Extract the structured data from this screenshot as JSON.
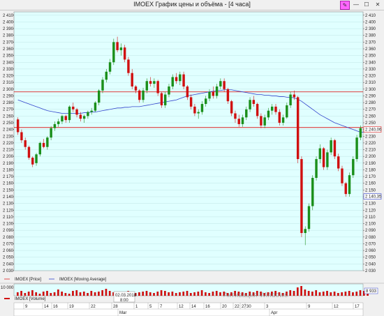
{
  "window": {
    "title": "IMOEX График цены и объёма - [4 часа]",
    "pin_icon": "pin-icon",
    "minimize_icon": "minimize-icon",
    "maximize_icon": "maximize-icon",
    "close_icon": "close-icon"
  },
  "colors": {
    "plot_bg": "#e0ffff",
    "up": "#1a8f1a",
    "down": "#d01010",
    "ma": "#3344cc",
    "level": "#dd2222",
    "grid": "#b8dede"
  },
  "price_labels": {
    "ma_value": "2 240,06",
    "last_price": "2 140,35"
  },
  "volume": {
    "axis_label": "10 000",
    "last_value": "8 933"
  },
  "legend": {
    "price": "IMOEX [Price]",
    "ma": "IMOEX [Moving Average]",
    "volume": "IMOEX [Volume]"
  },
  "cursor_label": {
    "date": "02.03.2018",
    "time": "8:00"
  },
  "watermark": "Активация Windows",
  "chart_data": {
    "type": "candlestick",
    "ylim": [
      2030,
      2415
    ],
    "y_ticks": [
      2030,
      2040,
      2050,
      2060,
      2070,
      2080,
      2090,
      2100,
      2110,
      2120,
      2130,
      2140,
      2150,
      2160,
      2170,
      2180,
      2190,
      2200,
      2210,
      2220,
      2230,
      2240,
      2250,
      2260,
      2270,
      2280,
      2290,
      2300,
      2310,
      2320,
      2330,
      2340,
      2350,
      2360,
      2370,
      2380,
      2390,
      2400,
      2410
    ],
    "y_tick_labels": [
      "2 030",
      "2 040",
      "2 050",
      "2 060",
      "2 070",
      "2 080",
      "2 090",
      "2 100",
      "2 110",
      "2 120",
      "2 130",
      "2 140",
      "2 150",
      "2 160",
      "2 170",
      "2 180",
      "2 190",
      "2 200",
      "2 210",
      "2 220",
      "2 230",
      "2 240",
      "2 250",
      "2 260",
      "2 270",
      "2 280",
      "2 290",
      "2 300",
      "2 310",
      "2 320",
      "2 330",
      "2 340",
      "2 350",
      "2 360",
      "2 370",
      "2 380",
      "2 390",
      "2 400",
      "2 410"
    ],
    "x_day_labels": [
      "9",
      "14",
      "16",
      "19",
      "22",
      "28",
      "1",
      "5",
      "7",
      "12",
      "14",
      "16",
      "20",
      "22",
      "27",
      "30",
      "3",
      "9",
      "12",
      "17"
    ],
    "month_labels": [
      "Mar",
      "Apr"
    ],
    "horizontal_levels": [
      2296,
      2243
    ],
    "ohlc": [
      [
        2255,
        2258,
        2232,
        2236
      ],
      [
        2236,
        2240,
        2220,
        2224
      ],
      [
        2224,
        2228,
        2210,
        2214
      ],
      [
        2214,
        2216,
        2195,
        2198
      ],
      [
        2198,
        2200,
        2184,
        2188
      ],
      [
        2190,
        2205,
        2186,
        2203
      ],
      [
        2203,
        2222,
        2200,
        2220
      ],
      [
        2220,
        2226,
        2212,
        2214
      ],
      [
        2214,
        2230,
        2210,
        2228
      ],
      [
        2228,
        2245,
        2224,
        2242
      ],
      [
        2242,
        2252,
        2238,
        2248
      ],
      [
        2248,
        2256,
        2244,
        2252
      ],
      [
        2252,
        2262,
        2248,
        2260
      ],
      [
        2260,
        2262,
        2250,
        2254
      ],
      [
        2254,
        2276,
        2250,
        2274
      ],
      [
        2274,
        2280,
        2266,
        2270
      ],
      [
        2270,
        2272,
        2258,
        2262
      ],
      [
        2262,
        2266,
        2252,
        2256
      ],
      [
        2256,
        2262,
        2250,
        2260
      ],
      [
        2260,
        2268,
        2256,
        2266
      ],
      [
        2266,
        2272,
        2262,
        2268
      ],
      [
        2268,
        2282,
        2266,
        2280
      ],
      [
        2280,
        2300,
        2276,
        2298
      ],
      [
        2298,
        2318,
        2294,
        2314
      ],
      [
        2314,
        2330,
        2310,
        2326
      ],
      [
        2326,
        2345,
        2322,
        2340
      ],
      [
        2340,
        2375,
        2336,
        2370
      ],
      [
        2370,
        2378,
        2355,
        2358
      ],
      [
        2358,
        2368,
        2350,
        2362
      ],
      [
        2362,
        2366,
        2340,
        2344
      ],
      [
        2344,
        2348,
        2320,
        2324
      ],
      [
        2324,
        2330,
        2300,
        2304
      ],
      [
        2304,
        2306,
        2294,
        2298
      ],
      [
        2298,
        2300,
        2280,
        2284
      ],
      [
        2284,
        2302,
        2280,
        2298
      ],
      [
        2298,
        2316,
        2294,
        2312
      ],
      [
        2312,
        2318,
        2304,
        2308
      ],
      [
        2308,
        2316,
        2302,
        2312
      ],
      [
        2312,
        2314,
        2290,
        2294
      ],
      [
        2294,
        2296,
        2272,
        2276
      ],
      [
        2276,
        2296,
        2272,
        2292
      ],
      [
        2292,
        2308,
        2288,
        2304
      ],
      [
        2304,
        2322,
        2300,
        2318
      ],
      [
        2318,
        2324,
        2308,
        2312
      ],
      [
        2312,
        2326,
        2306,
        2322
      ],
      [
        2322,
        2326,
        2300,
        2304
      ],
      [
        2304,
        2306,
        2284,
        2288
      ],
      [
        2288,
        2292,
        2270,
        2274
      ],
      [
        2274,
        2278,
        2260,
        2264
      ],
      [
        2264,
        2270,
        2256,
        2266
      ],
      [
        2266,
        2282,
        2262,
        2278
      ],
      [
        2278,
        2290,
        2274,
        2286
      ],
      [
        2286,
        2300,
        2282,
        2296
      ],
      [
        2296,
        2304,
        2286,
        2290
      ],
      [
        2290,
        2308,
        2286,
        2304
      ],
      [
        2304,
        2316,
        2300,
        2312
      ],
      [
        2312,
        2316,
        2296,
        2300
      ],
      [
        2300,
        2302,
        2278,
        2282
      ],
      [
        2282,
        2284,
        2260,
        2264
      ],
      [
        2264,
        2268,
        2250,
        2256
      ],
      [
        2256,
        2262,
        2244,
        2248
      ],
      [
        2248,
        2262,
        2244,
        2258
      ],
      [
        2258,
        2274,
        2254,
        2270
      ],
      [
        2270,
        2288,
        2266,
        2284
      ],
      [
        2284,
        2290,
        2274,
        2278
      ],
      [
        2278,
        2280,
        2256,
        2260
      ],
      [
        2260,
        2264,
        2242,
        2246
      ],
      [
        2246,
        2262,
        2242,
        2258
      ],
      [
        2258,
        2272,
        2254,
        2268
      ],
      [
        2268,
        2278,
        2262,
        2274
      ],
      [
        2274,
        2278,
        2262,
        2266
      ],
      [
        2266,
        2270,
        2246,
        2250
      ],
      [
        2250,
        2262,
        2246,
        2258
      ],
      [
        2258,
        2280,
        2256,
        2276
      ],
      [
        2276,
        2296,
        2272,
        2292
      ],
      [
        2292,
        2298,
        2284,
        2288
      ],
      [
        2288,
        2290,
        2190,
        2196
      ],
      [
        2196,
        2200,
        2080,
        2086
      ],
      [
        2086,
        2096,
        2068,
        2092
      ],
      [
        2092,
        2130,
        2088,
        2126
      ],
      [
        2126,
        2172,
        2120,
        2168
      ],
      [
        2168,
        2200,
        2164,
        2196
      ],
      [
        2196,
        2218,
        2190,
        2212
      ],
      [
        2212,
        2214,
        2180,
        2184
      ],
      [
        2184,
        2210,
        2180,
        2206
      ],
      [
        2206,
        2228,
        2202,
        2224
      ],
      [
        2224,
        2226,
        2196,
        2200
      ],
      [
        2200,
        2204,
        2178,
        2182
      ],
      [
        2182,
        2186,
        2156,
        2160
      ],
      [
        2160,
        2162,
        2140,
        2144
      ],
      [
        2144,
        2176,
        2140,
        2172
      ],
      [
        2172,
        2200,
        2168,
        2196
      ],
      [
        2196,
        2232,
        2192,
        2228
      ],
      [
        2228,
        2246,
        2224,
        2242
      ]
    ],
    "moving_average": [
      2284,
      2282,
      2280,
      2278,
      2276,
      2274,
      2272,
      2270,
      2268,
      2267,
      2266,
      2265,
      2264,
      2264,
      2264,
      2264,
      2264,
      2264,
      2265,
      2265,
      2266,
      2266,
      2267,
      2268,
      2269,
      2270,
      2271,
      2272,
      2272,
      2273,
      2273,
      2274,
      2274,
      2274,
      2275,
      2276,
      2277,
      2278,
      2279,
      2280,
      2281,
      2282,
      2283,
      2284,
      2286,
      2288,
      2290,
      2291,
      2292,
      2293,
      2294,
      2295,
      2296,
      2297,
      2298,
      2298,
      2299,
      2299,
      2299,
      2298,
      2297,
      2296,
      2295,
      2294,
      2293,
      2292,
      2292,
      2291,
      2291,
      2290,
      2290,
      2289,
      2289,
      2288,
      2288,
      2287,
      2285,
      2282,
      2278,
      2274,
      2270,
      2266,
      2262,
      2259,
      2256,
      2253,
      2250,
      2248,
      2246,
      2244,
      2242,
      2240,
      2238,
      2236,
      2236,
      2240
    ],
    "volumes": [
      5,
      7,
      4,
      6,
      8,
      5,
      3,
      6,
      7,
      4,
      5,
      9,
      6,
      4,
      3,
      7,
      8,
      5,
      6,
      4,
      7,
      5,
      6,
      8,
      10,
      7,
      5,
      6,
      4,
      5,
      7,
      6,
      4,
      5,
      6,
      7,
      5,
      4,
      6,
      8,
      7,
      5,
      6,
      4,
      5,
      6,
      7,
      4,
      5,
      6,
      8,
      5,
      4,
      6,
      7,
      5,
      6,
      4,
      5,
      7,
      6,
      5,
      4,
      6,
      5,
      7,
      6,
      4,
      5,
      6,
      7,
      5,
      4,
      6,
      8,
      7,
      12,
      14,
      9,
      7,
      6,
      8,
      5,
      6,
      7,
      5,
      6,
      4,
      5,
      6,
      7,
      5,
      6,
      8,
      7,
      9
    ]
  }
}
